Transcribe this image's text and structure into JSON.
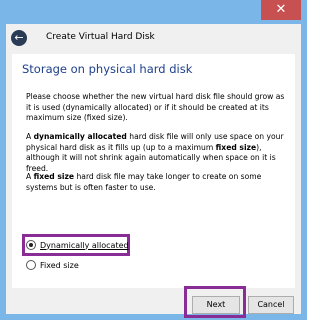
{
  "window": {
    "close_glyph": "✕"
  },
  "header": {
    "back_glyph": "←",
    "title": "Create Virtual Hard Disk"
  },
  "content": {
    "heading": "Storage on physical hard disk",
    "para1": "Please choose whether the new virtual hard disk file should grow as it is used (dynamically allocated) or if it should be created at its maximum size (fixed size).",
    "para2": {
      "pre": "A ",
      "bold1": "dynamically allocated",
      "mid1": " hard disk file will only use space on your physical hard disk as it fills up (up to a maximum ",
      "bold2": "fixed size",
      "post": "), although it will not shrink again automatically when space on it is freed."
    },
    "para3": {
      "pre": "A ",
      "bold": "fixed size",
      "post": " hard disk file may take longer to create on some systems but is often faster to use."
    },
    "options": [
      {
        "label": "Dynamically allocated",
        "selected": true
      },
      {
        "label": "Fixed size",
        "selected": false
      }
    ]
  },
  "footer": {
    "next_label": "Next",
    "cancel_label": "Cancel"
  },
  "colors": {
    "frame": "#7ab6e8",
    "heading": "#1e3f8a",
    "highlight": "#8a2c96",
    "close": "#c75050"
  }
}
